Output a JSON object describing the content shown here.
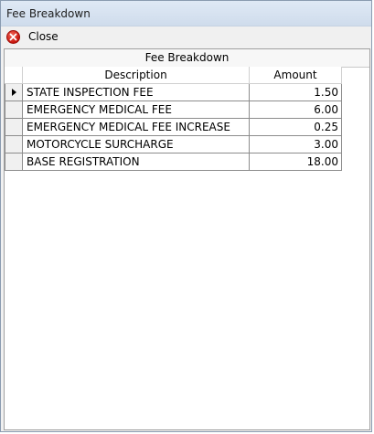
{
  "window": {
    "title": "Fee Breakdown"
  },
  "toolbar": {
    "close_label": "Close",
    "close_icon": "close-x-icon"
  },
  "grid": {
    "caption": "Fee Breakdown",
    "columns": [
      "Description",
      "Amount"
    ],
    "selected_row_indicator": "row-selector-arrow-icon",
    "rows": [
      {
        "description": "STATE INSPECTION FEE",
        "amount": "1.50"
      },
      {
        "description": "EMERGENCY MEDICAL FEE",
        "amount": "6.00"
      },
      {
        "description": "EMERGENCY MEDICAL FEE INCREASE",
        "amount": "0.25"
      },
      {
        "description": "MOTORCYCLE SURCHARGE",
        "amount": "3.00"
      },
      {
        "description": "BASE REGISTRATION",
        "amount": "18.00"
      }
    ]
  },
  "colors": {
    "titlebar": "#d9e4f1",
    "close_icon": "#d42a1e",
    "grid_line": "#8c8c8c"
  }
}
